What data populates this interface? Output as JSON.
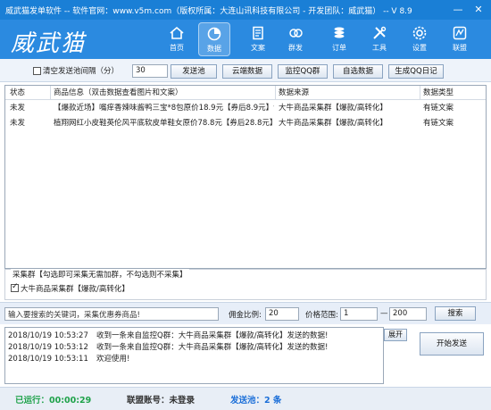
{
  "window": {
    "title": "威武猫发单软件 -- 软件官网：www.v5m.com（版权所属：大连山讯科技有限公司 - 开发团队：威武猫） -- V 8.9",
    "minimize": "—",
    "close": "✕"
  },
  "brand": {
    "logo_text": "威武猫"
  },
  "nav": {
    "items": [
      {
        "label": "首页",
        "icon": "home-icon"
      },
      {
        "label": "数据",
        "icon": "pie-chart-icon"
      },
      {
        "label": "文案",
        "icon": "document-icon"
      },
      {
        "label": "群发",
        "icon": "broadcast-icon"
      },
      {
        "label": "订单",
        "icon": "coins-icon"
      },
      {
        "label": "工具",
        "icon": "tools-icon"
      },
      {
        "label": "设置",
        "icon": "gear-icon"
      },
      {
        "label": "联盟",
        "icon": "alliance-icon"
      }
    ],
    "active_index": 1
  },
  "toolbar": {
    "clear_label": "清空发送池间隔（分）",
    "clear_checked": false,
    "interval_value": "30",
    "tabs": [
      "发送池",
      "云端数据",
      "监控QQ群",
      "自选数据",
      "生成QQ日记"
    ]
  },
  "grid": {
    "columns": [
      "状态",
      "商品信息（双击数据查看图片和文案）",
      "数据来源",
      "数据类型"
    ],
    "rows": [
      {
        "status": "未发",
        "info": "【爆款近场】嘴痒香辣味酱鸭三宝*8包原价18.9元【券后8.9元】包...",
        "source": "大牛商品采集群【爆款/高转化】",
        "type": "有链文案"
      },
      {
        "status": "未发",
        "info": "植翔网红小皮鞋英伦风平底软皮单鞋女原价78.8元【券后28.8元】包...",
        "source": "大牛商品采集群【爆款/高转化】",
        "type": "有链文案"
      }
    ]
  },
  "collect_group": {
    "title": "采集群【勾选即可采集无需加群，不勾选则不采集】",
    "items": [
      {
        "label": "大牛商品采集群【爆款/高转化】",
        "checked": true
      }
    ]
  },
  "keyword_bar": {
    "placeholder": "输入要搜索的关键词，采集优惠券商品!",
    "commission_label": "佣金比例:",
    "commission_value": "20",
    "price_label": "价格范围:",
    "price_min": "1",
    "price_sep": "—",
    "price_max": "200",
    "search_label": "搜索"
  },
  "log": {
    "rows": [
      {
        "time": "2018/10/19 10:53:27",
        "msg": "收到一条来自监控Q群：大牛商品采集群【爆款/高转化】发送的数据!"
      },
      {
        "time": "2018/10/19 10:53:12",
        "msg": "收到一条来自监控Q群：大牛商品采集群【爆款/高转化】发送的数据!"
      },
      {
        "time": "2018/10/19 10:53:11",
        "msg": "欢迎使用!"
      }
    ],
    "expand_label": "展开",
    "start_label": "开始发送"
  },
  "statusbar": {
    "runtime": "已运行：00:00:29",
    "account": "联盟账号：未登录",
    "pool": "发送池：2 条"
  },
  "colors": {
    "titlebar": "#1a7fd6",
    "header": "#2b8ae0",
    "status_green": "#1fa24a",
    "status_blue": "#1a6ed8"
  }
}
